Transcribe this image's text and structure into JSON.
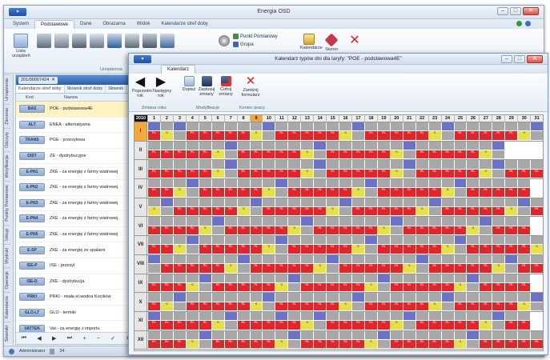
{
  "main_window": {
    "title": "Energia OSD",
    "win_buttons": [
      "–",
      "□",
      "✕"
    ],
    "tabs": [
      "System",
      "Podstawowe",
      "Dane",
      "Obrazarna",
      "Widok",
      "Kalendarze stref doby"
    ],
    "selected_tab": "Podstawowe",
    "ribbon": {
      "list_button": "Lista urządzeń",
      "group_caption": "Urządzenia",
      "side_buttons": [
        "Punkt Pomiarowy",
        "Grupa"
      ],
      "extra_buttons": [
        "Kalendarze",
        "Sezon",
        "Zamknij"
      ]
    },
    "side_tabs": [
      "Urządzenia",
      "Zlecenia",
      "Odczyty",
      "Weryfikacja",
      "Punkty Pomiarowe",
      "Usługi",
      "Wydruki",
      "Operacje",
      "Kalendarze",
      "Słowniki"
    ],
    "doc_tab": "201/00007424",
    "sub_tabs": [
      "Kalendarze stref doby",
      "Słownik stref doby",
      "Słownik"
    ],
    "columns": [
      "Kod",
      "Nazwa"
    ],
    "rows": [
      {
        "code": "BAS",
        "name": "POE - podstawowa4E"
      },
      {
        "code": "ALT",
        "name": "ENEA - alternatywna"
      },
      {
        "code": "TRANS",
        "name": "PGE - przesyłowa"
      },
      {
        "code": "DIST",
        "name": "ZE - dystrybucyjne"
      },
      {
        "code": "E-PN1",
        "name": "ZKE - za energię z farmy wiatrowej"
      },
      {
        "code": "E-PN2",
        "name": "ZKE - za energię z farmy wiatrowej"
      },
      {
        "code": "E-PN3",
        "name": "ZKE - za energię z farmy wiatrowej"
      },
      {
        "code": "E-PN4",
        "name": "ZKE - za energię z farmy wiatrowej"
      },
      {
        "code": "E-PN5",
        "name": "ZKE - za energię z farmy wiatrowej"
      },
      {
        "code": "E-SP",
        "name": "ZKE - za energię ze spalarni"
      },
      {
        "code": "ISE-P",
        "name": "ISE - przesył"
      },
      {
        "code": "ISE-D",
        "name": "ZKE - dystrybucja"
      },
      {
        "code": "PRKI",
        "name": "PRKI - miała el.wodna Kocików"
      },
      {
        "code": "GLO-LT",
        "name": "GLO - termiki"
      },
      {
        "code": "VATTEN",
        "name": "Vat - za energię z importu"
      }
    ],
    "nav_buttons": [
      "⏮",
      "◀",
      "▶",
      "⏭",
      "+",
      "−",
      "✓",
      "✕"
    ],
    "status": {
      "user": "Administrator",
      "count": "34"
    }
  },
  "calendar_window": {
    "title": "Kalendarz typów dni dla taryfy: \"POE - podstawowa4E\"",
    "tabs": [
      "Kalendarz"
    ],
    "ribbon_buttons": [
      "Poprzedni rok",
      "Następny rok",
      "Dopisz",
      "Zastosuj zmiany",
      "Cofnij zmiany",
      "Zamknij formularz"
    ],
    "group_captions": [
      "Zmiana roku",
      "Modyfikacje",
      "Koniec pracy"
    ],
    "year": "2010",
    "highlighted_day": 9,
    "days": [
      "1",
      "2",
      "3",
      "4",
      "5",
      "6",
      "7",
      "8",
      "9",
      "10",
      "11",
      "12",
      "13",
      "14",
      "15",
      "16",
      "17",
      "18",
      "19",
      "20",
      "21",
      "22",
      "23",
      "24",
      "25",
      "26",
      "27",
      "28",
      "29",
      "30",
      "31"
    ],
    "months": [
      "I",
      "II",
      "III",
      "IV",
      "V",
      "VI",
      "VII",
      "VIII",
      "IX",
      "X",
      "XI",
      "XII"
    ],
    "selected_month": "I",
    "days_in_month": [
      31,
      28,
      31,
      30,
      31,
      30,
      31,
      31,
      30,
      31,
      30,
      31
    ],
    "first_weekday": [
      4,
      0,
      0,
      3,
      5,
      1,
      3,
      6,
      2,
      4,
      0,
      2
    ],
    "cell_labels": {
      "weekday": "RL",
      "saturday": "S",
      "sunday": "N",
      "holiday": "Św"
    },
    "colors": {
      "weekday": "#e0262b",
      "saturday": "#e8e04a",
      "sunday": "#a8a8a8",
      "holiday": "#6b73c8",
      "highlight": "#f2a93b"
    }
  }
}
